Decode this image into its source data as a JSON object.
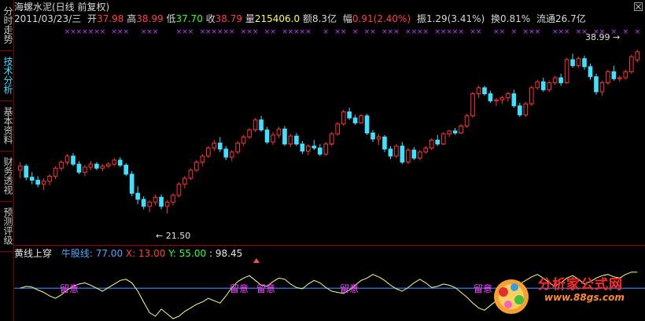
{
  "side_tabs": [
    {
      "label": "分时走势",
      "active": false
    },
    {
      "label": "技术分析",
      "active": true
    },
    {
      "label": "基本资料",
      "active": false
    },
    {
      "label": "财务透视",
      "active": false
    },
    {
      "label": "预测评级",
      "active": false
    }
  ],
  "info_bar": {
    "title": "海螺水泥(日线 前复权)",
    "date": "2011/03/23/三",
    "open_label": "开",
    "open": "37.98",
    "high_label": "高",
    "high": "38.99",
    "low_label": "低",
    "low": "37.70",
    "close_label": "收",
    "close": "38.79",
    "volume_label": "量",
    "volume": "215406.0",
    "amount_label": "额",
    "amount": "8.3亿",
    "change_label": "幅",
    "change": "0.91(2.40%)",
    "amplitude_label": "振",
    "amplitude": "1.29(3.41%)",
    "turnover_label": "换",
    "turnover": "0.81%",
    "float_label": "流通",
    "float": "26.7亿"
  },
  "price_labels": {
    "high_marker": "38.99",
    "low_marker": "21.50"
  },
  "indicator": {
    "name": "黄线上穿",
    "line1_label": "牛股线:",
    "line1_value": "77.00",
    "x_label": "X:",
    "x_value": "13.00",
    "y_label": "Y:",
    "y_value": "55.00",
    "extra_label": ":",
    "extra_value": "98.45",
    "watch_label": "留意"
  },
  "watermark": {
    "text": "分析家公式网",
    "url": "www.88gs.com"
  },
  "colors": {
    "up": "#ff3232",
    "down": "#40e0ff",
    "signal": "#c040ff",
    "yellow_line": "#ffff80",
    "blue_line": "#3c8cff"
  },
  "chart_data": {
    "type": "candlestick",
    "ylim": [
      20.5,
      40.5
    ],
    "candles": [
      [
        27.0,
        27.8,
        26.2,
        27.4
      ],
      [
        27.4,
        27.6,
        26.0,
        26.3
      ],
      [
        26.3,
        26.8,
        25.6,
        26.0
      ],
      [
        26.0,
        26.4,
        25.3,
        25.6
      ],
      [
        25.6,
        26.2,
        25.0,
        25.9
      ],
      [
        25.9,
        26.6,
        25.5,
        26.4
      ],
      [
        26.4,
        27.4,
        26.1,
        27.2
      ],
      [
        27.2,
        28.0,
        26.9,
        27.8
      ],
      [
        27.8,
        28.6,
        27.5,
        28.4
      ],
      [
        28.4,
        28.7,
        27.4,
        27.6
      ],
      [
        27.6,
        27.9,
        26.6,
        26.8
      ],
      [
        26.8,
        27.5,
        26.4,
        27.3
      ],
      [
        27.3,
        27.9,
        27.0,
        27.6
      ],
      [
        27.6,
        27.8,
        27.0,
        27.2
      ],
      [
        27.2,
        27.6,
        26.9,
        27.4
      ],
      [
        27.4,
        27.8,
        27.2,
        27.6
      ],
      [
        27.6,
        28.2,
        27.4,
        28.0
      ],
      [
        28.0,
        28.3,
        27.3,
        27.5
      ],
      [
        27.5,
        27.7,
        26.4,
        26.6
      ],
      [
        26.6,
        26.9,
        24.4,
        24.7
      ],
      [
        24.7,
        25.4,
        23.6,
        24.1
      ],
      [
        24.1,
        24.4,
        23.1,
        23.4
      ],
      [
        23.4,
        24.0,
        22.8,
        23.8
      ],
      [
        23.8,
        24.6,
        23.5,
        24.3
      ],
      [
        24.3,
        24.6,
        23.1,
        23.4
      ],
      [
        23.4,
        24.0,
        22.7,
        23.8
      ],
      [
        23.8,
        24.7,
        23.5,
        24.5
      ],
      [
        24.5,
        25.8,
        24.3,
        25.6
      ],
      [
        25.6,
        26.4,
        25.2,
        26.2
      ],
      [
        26.2,
        27.2,
        26.0,
        27.0
      ],
      [
        27.0,
        28.0,
        26.8,
        27.8
      ],
      [
        27.8,
        28.6,
        27.4,
        28.4
      ],
      [
        28.4,
        29.4,
        28.2,
        29.2
      ],
      [
        29.2,
        30.0,
        28.9,
        29.7
      ],
      [
        29.7,
        30.3,
        28.8,
        29.1
      ],
      [
        29.1,
        29.4,
        28.0,
        28.3
      ],
      [
        28.3,
        29.0,
        27.9,
        28.8
      ],
      [
        28.8,
        29.9,
        28.6,
        29.7
      ],
      [
        29.7,
        30.5,
        29.4,
        30.3
      ],
      [
        30.3,
        31.2,
        30.1,
        31.0
      ],
      [
        31.0,
        32.2,
        30.8,
        32.0
      ],
      [
        32.0,
        32.4,
        30.8,
        31.0
      ],
      [
        31.0,
        31.3,
        29.6,
        29.8
      ],
      [
        29.8,
        30.8,
        29.5,
        30.5
      ],
      [
        30.5,
        31.3,
        30.2,
        31.1
      ],
      [
        31.1,
        31.4,
        29.4,
        29.6
      ],
      [
        29.6,
        30.6,
        29.3,
        30.4
      ],
      [
        30.4,
        30.7,
        29.4,
        29.6
      ],
      [
        29.6,
        29.9,
        28.6,
        28.9
      ],
      [
        28.9,
        29.6,
        28.5,
        29.4
      ],
      [
        29.4,
        30.0,
        29.0,
        29.2
      ],
      [
        29.2,
        29.6,
        28.4,
        28.6
      ],
      [
        28.6,
        29.8,
        28.4,
        29.6
      ],
      [
        29.6,
        30.8,
        29.4,
        30.6
      ],
      [
        30.6,
        31.8,
        30.4,
        31.6
      ],
      [
        31.6,
        33.0,
        31.4,
        32.8
      ],
      [
        32.8,
        33.2,
        32.0,
        32.2
      ],
      [
        32.2,
        32.5,
        31.5,
        31.7
      ],
      [
        31.7,
        32.6,
        31.6,
        32.4
      ],
      [
        32.4,
        32.6,
        30.5,
        30.7
      ],
      [
        30.7,
        31.0,
        29.8,
        30.1
      ],
      [
        30.1,
        30.6,
        29.5,
        30.3
      ],
      [
        30.3,
        30.5,
        28.8,
        29.1
      ],
      [
        29.1,
        29.4,
        28.1,
        28.4
      ],
      [
        28.4,
        29.6,
        28.2,
        29.4
      ],
      [
        29.4,
        29.8,
        27.6,
        27.8
      ],
      [
        27.8,
        29.2,
        27.6,
        29.0
      ],
      [
        29.0,
        29.3,
        28.0,
        28.2
      ],
      [
        28.2,
        29.0,
        28.0,
        28.8
      ],
      [
        28.8,
        29.4,
        28.6,
        29.2
      ],
      [
        29.2,
        30.2,
        29.0,
        30.0
      ],
      [
        30.0,
        30.5,
        29.4,
        29.6
      ],
      [
        29.6,
        30.8,
        29.5,
        30.6
      ],
      [
        30.6,
        31.0,
        30.3,
        30.9
      ],
      [
        30.9,
        31.2,
        30.5,
        30.7
      ],
      [
        30.7,
        31.6,
        30.6,
        31.4
      ],
      [
        31.4,
        32.6,
        31.2,
        32.4
      ],
      [
        32.4,
        34.8,
        32.2,
        34.6
      ],
      [
        34.6,
        35.4,
        34.2,
        35.2
      ],
      [
        35.2,
        35.4,
        34.4,
        34.6
      ],
      [
        34.6,
        34.9,
        33.7,
        33.9
      ],
      [
        33.9,
        34.2,
        33.4,
        34.0
      ],
      [
        34.0,
        34.4,
        33.6,
        34.2
      ],
      [
        34.2,
        34.8,
        33.8,
        34.6
      ],
      [
        34.6,
        35.0,
        33.2,
        33.4
      ],
      [
        33.4,
        33.7,
        32.3,
        32.5
      ],
      [
        32.5,
        33.8,
        32.3,
        33.6
      ],
      [
        33.6,
        35.4,
        33.4,
        35.2
      ],
      [
        35.2,
        36.0,
        35.0,
        35.8
      ],
      [
        35.8,
        36.2,
        34.8,
        35.0
      ],
      [
        35.0,
        35.9,
        34.8,
        35.7
      ],
      [
        35.7,
        36.4,
        35.5,
        36.2
      ],
      [
        36.2,
        36.6,
        35.4,
        35.7
      ],
      [
        35.7,
        38.2,
        35.6,
        38.0
      ],
      [
        38.0,
        38.6,
        37.2,
        37.4
      ],
      [
        37.4,
        38.3,
        37.2,
        38.1
      ],
      [
        38.1,
        38.4,
        37.0,
        37.3
      ],
      [
        37.3,
        37.6,
        36.0,
        36.3
      ],
      [
        36.3,
        36.6,
        34.5,
        34.8
      ],
      [
        34.8,
        35.9,
        34.4,
        35.7
      ],
      [
        35.7,
        37.0,
        35.5,
        36.8
      ],
      [
        36.8,
        37.4,
        35.9,
        36.1
      ],
      [
        36.1,
        36.4,
        35.8,
        36.2
      ],
      [
        36.2,
        37.0,
        36.0,
        36.8
      ],
      [
        36.8,
        38.5,
        36.6,
        38.3
      ],
      [
        37.98,
        38.99,
        37.7,
        38.79
      ]
    ],
    "signal_marks_top": [
      8,
      9,
      10,
      11,
      12,
      13,
      14,
      16,
      17,
      18,
      21,
      22,
      23,
      27,
      28,
      29,
      31,
      32,
      33,
      34,
      35,
      36,
      38,
      39,
      40,
      42,
      43,
      45,
      46,
      47,
      48,
      49,
      52,
      54,
      55,
      57,
      59,
      60,
      62,
      63,
      64,
      66,
      67,
      68,
      69,
      71,
      72,
      73,
      74,
      75,
      77,
      78,
      81,
      82,
      84,
      86,
      87,
      88,
      91,
      92,
      93,
      95,
      96,
      98,
      99,
      101,
      103,
      105
    ],
    "high_marker_index": 105,
    "low_marker_index": 26,
    "indicator_series": [
      55,
      58,
      57,
      52,
      48,
      42,
      38,
      44,
      52,
      58,
      62,
      64,
      60,
      55,
      50,
      56,
      62,
      68,
      70,
      64,
      50,
      32,
      14,
      8,
      20,
      12,
      4,
      8,
      16,
      22,
      28,
      32,
      38,
      34,
      30,
      42,
      56,
      66,
      72,
      76,
      68,
      60,
      58,
      66,
      72,
      70,
      62,
      56,
      54,
      62,
      68,
      64,
      56,
      50,
      48,
      46,
      52,
      60,
      68,
      72,
      78,
      74,
      68,
      60,
      54,
      50,
      56,
      64,
      70,
      64,
      56,
      58,
      62,
      60,
      56,
      48,
      40,
      30,
      22,
      18,
      26,
      34,
      44,
      52,
      58,
      62,
      68,
      74,
      78,
      72,
      64,
      58,
      64,
      72,
      76,
      70,
      62,
      66,
      72,
      76,
      78,
      74,
      72,
      78,
      82,
      82
    ],
    "indicator_line_level": 55,
    "indicator_ylim": [
      0,
      100
    ]
  }
}
